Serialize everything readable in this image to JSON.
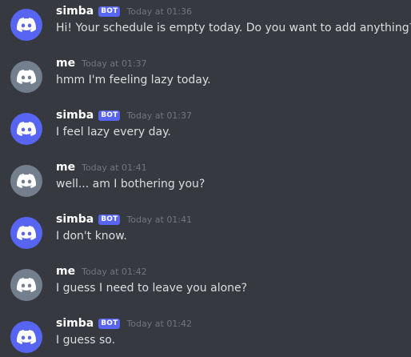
{
  "colors": {
    "background": "#36393f",
    "bot_avatar": "#5865f2",
    "user_avatar": "#747f8d",
    "bot_tag": "#5865f2"
  },
  "messages": [
    {
      "author": "simba",
      "is_bot": true,
      "bot_tag": "BOT",
      "timestamp": "Today at 01:36",
      "text": "Hi! Your schedule is empty today. Do you want to add anything?"
    },
    {
      "author": "me",
      "is_bot": false,
      "timestamp": "Today at 01:37",
      "text": "hmm I'm feeling lazy today."
    },
    {
      "author": "simba",
      "is_bot": true,
      "bot_tag": "BOT",
      "timestamp": "Today at 01:37",
      "text": "I feel lazy every day."
    },
    {
      "author": "me",
      "is_bot": false,
      "timestamp": "Today at 01:41",
      "text": "well... am I bothering you?"
    },
    {
      "author": "simba",
      "is_bot": true,
      "bot_tag": "BOT",
      "timestamp": "Today at 01:41",
      "text": "I don't know."
    },
    {
      "author": "me",
      "is_bot": false,
      "timestamp": "Today at 01:42",
      "text": "I guess I need to leave you alone?"
    },
    {
      "author": "simba",
      "is_bot": true,
      "bot_tag": "BOT",
      "timestamp": "Today at 01:42",
      "text": "I guess so."
    }
  ]
}
